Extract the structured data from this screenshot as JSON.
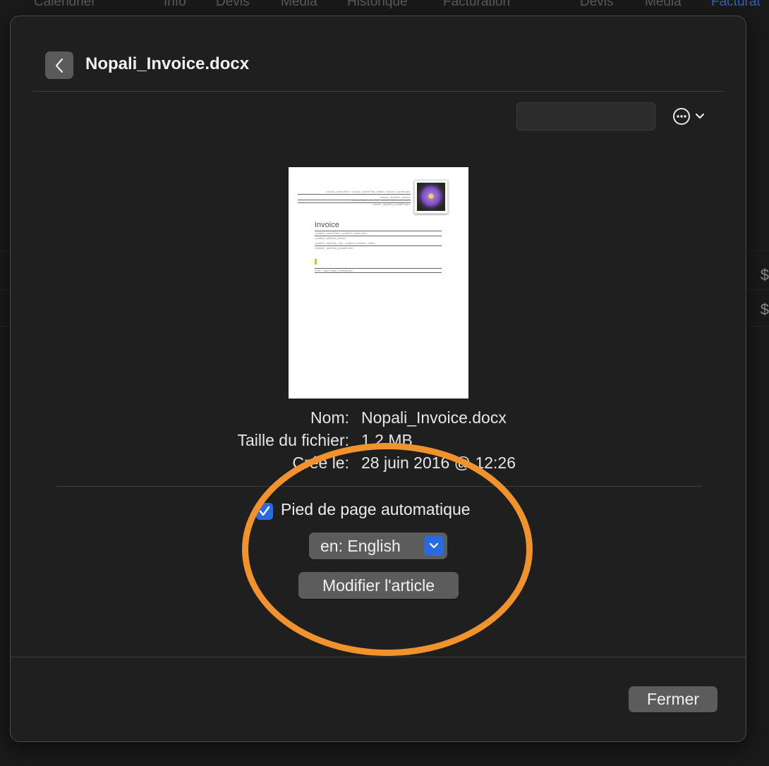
{
  "background": {
    "tabs": [
      "Calendrier",
      "Info",
      "Devis",
      "Media",
      "Historique",
      "Facturation",
      "Devis",
      "Media",
      "Facturat"
    ],
    "currency_symbols": [
      "$",
      "$"
    ]
  },
  "sheet": {
    "title": "Nopali_Invoice.docx",
    "search": {
      "value": ""
    },
    "document_preview": {
      "heading": "Invoice",
      "header_lines": [
        "<doctor_nameTitle> <doctor_nameFirst_Initial> <doctor_nameLast>",
        "<doctor_address_street>",
        "<doctor_address_city> <doctor_address_state>",
        "<doctor_address_postalCode>"
      ],
      "body_lines": [
        "<patient_nameFirst> <patient_nameLast>",
        "<patient_address_street>",
        "<patient_address_city> <patient_address_state>",
        "<patient_address_postalCode>"
      ],
      "footer_line": "Print: <dateToday_timestamp>"
    },
    "info": {
      "name_label": "Nom:",
      "name_value": "Nopali_Invoice.docx",
      "size_label": "Taille du fichier:",
      "size_value": "1.2 MB",
      "created_label": "Créé le:",
      "created_value": "28 juin 2016 @ 12:26"
    },
    "auto_footer": {
      "label": "Pied de page automatique",
      "checked": true
    },
    "language_popup": {
      "selected": "en: English"
    },
    "edit_button": "Modifier l'article",
    "close_button": "Fermer"
  },
  "colors": {
    "accent": "#2a6ae0",
    "annotation": "#f0922e",
    "sheet_bg": "#1f1f1f"
  },
  "icons": [
    "chevron-left-icon",
    "ellipsis-circle-icon",
    "chevron-down-icon",
    "checkmark-icon",
    "flower-photo"
  ]
}
